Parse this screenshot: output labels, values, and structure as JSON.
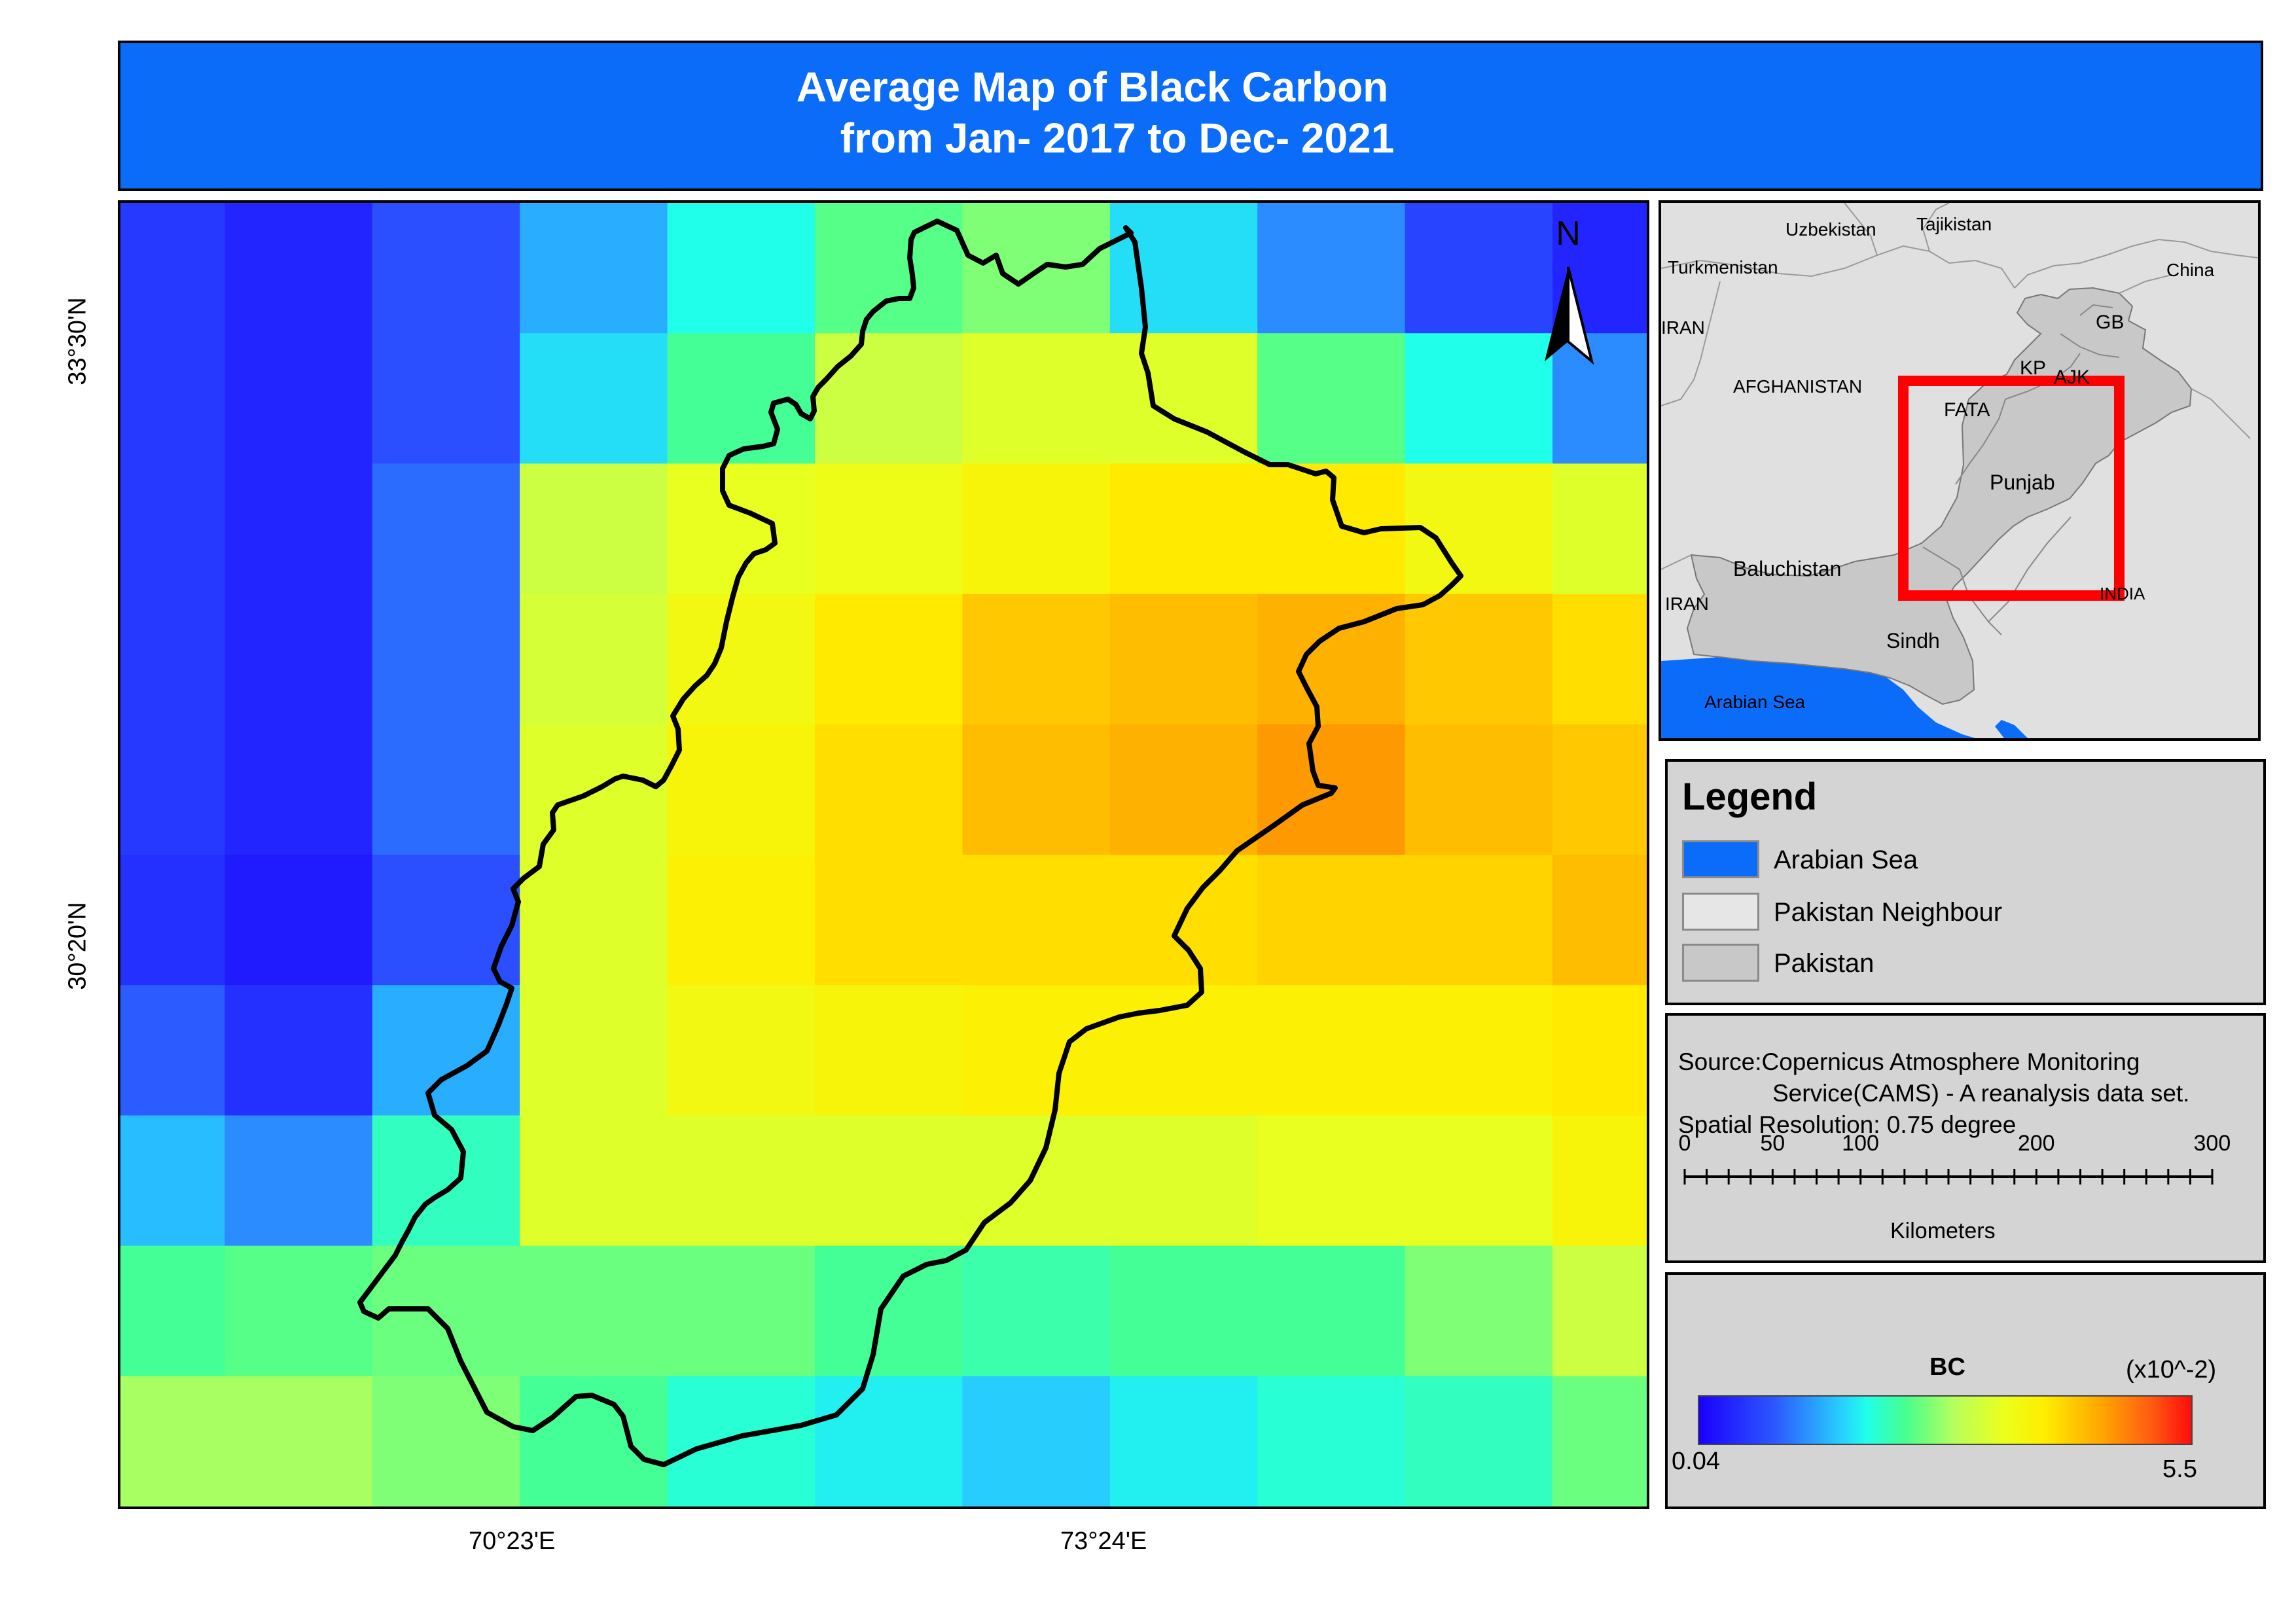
{
  "title": {
    "line1": "Average Map of Black Carbon",
    "line2": "from Jan- 2017 to Dec- 2021"
  },
  "north_arrow": {
    "label": "N"
  },
  "axes": {
    "latitude_labels": [
      "33°30'N",
      "30°20'N"
    ],
    "longitude_labels": [
      "70°23'E",
      "73°24'E"
    ]
  },
  "colors": {
    "title_bar": "#0a6cf8",
    "arabian_sea": "#0a6cf8",
    "pakistan_neighbour": "#e0e0e0",
    "pakistan": "#c8c8c8",
    "study_area_box": "#ff0000",
    "boundary": "#000000"
  },
  "bc_grid": {
    "rows": 9,
    "cols": 11,
    "values": [
      [
        0.6,
        0.4,
        0.8,
        1.4,
        1.9,
        2.4,
        2.6,
        1.7,
        1.2,
        0.7,
        0.4
      ],
      [
        0.6,
        0.4,
        0.8,
        1.7,
        2.3,
        3.1,
        3.3,
        3.3,
        2.4,
        1.9,
        1.2
      ],
      [
        0.6,
        0.4,
        1.0,
        3.1,
        3.4,
        3.5,
        3.7,
        3.9,
        3.9,
        3.6,
        3.3
      ],
      [
        0.6,
        0.4,
        1.0,
        3.2,
        3.6,
        3.9,
        4.2,
        4.3,
        4.4,
        4.2,
        4.0
      ],
      [
        0.6,
        0.4,
        1.0,
        3.3,
        3.7,
        4.0,
        4.3,
        4.4,
        4.6,
        4.3,
        4.2
      ],
      [
        0.5,
        0.3,
        0.8,
        3.3,
        3.8,
        4.0,
        4.0,
        4.0,
        4.1,
        4.1,
        4.3
      ],
      [
        0.9,
        0.5,
        1.4,
        3.3,
        3.6,
        3.7,
        3.8,
        3.8,
        3.8,
        3.8,
        3.9
      ],
      [
        1.5,
        1.2,
        2.1,
        3.3,
        3.3,
        3.3,
        3.3,
        3.3,
        3.4,
        3.4,
        3.7
      ],
      [
        2.3,
        2.4,
        2.5,
        2.5,
        2.5,
        2.3,
        2.2,
        2.3,
        2.3,
        2.6,
        3.1
      ],
      [
        2.8,
        2.8,
        2.6,
        2.3,
        2.0,
        1.8,
        1.6,
        1.8,
        2.0,
        2.1,
        2.5
      ]
    ]
  },
  "inset": {
    "labels": {
      "uzbekistan": "Uzbekistan",
      "tajikistan": "Tajikistan",
      "turkmenistan": "Turkmenistan",
      "china": "China",
      "iran_top": "IRAN",
      "gb": "GB",
      "afghanistan": "AFGHANISTAN",
      "kp": "KP",
      "ajk": "AJK",
      "fata": "FATA",
      "punjab": "Punjab",
      "baluchistan": "Baluchistan",
      "iran_bottom": "IRAN",
      "india": "INDIA",
      "sindh": "Sindh",
      "arabian_sea": "Arabian Sea"
    }
  },
  "legend": {
    "title": "Legend",
    "items": [
      {
        "label": "Arabian Sea",
        "color": "#0a6cf8"
      },
      {
        "label": "Pakistan Neighbour",
        "color": "#e6e6e6"
      },
      {
        "label": "Pakistan",
        "color": "#c8c8c8"
      }
    ]
  },
  "source": {
    "line1": "Source:Copernicus Atmosphere Monitoring",
    "line2": "Service(CAMS) - A reanalysis data set.",
    "line3": "Spatial Resolution: 0.75 degree",
    "scale_ticks": [
      "0",
      "50",
      "100",
      "200",
      "300"
    ],
    "scale_values": [
      0,
      50,
      100,
      200,
      300
    ],
    "scale_unit": "Kilometers"
  },
  "bc_legend": {
    "title": "BC",
    "unit": "(x10^-2)",
    "min": "0.04",
    "max": "5.5",
    "min_value": 0.04,
    "max_value": 5.5
  }
}
